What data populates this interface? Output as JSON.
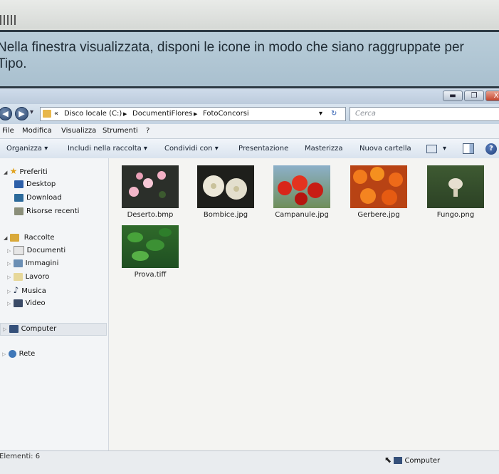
{
  "question": {
    "text": "Nella finestra visualizzata, disponi le icone in modo che siano raggruppate per Tipo."
  },
  "window": {
    "controls": {
      "minimize": "▬",
      "maximize": "❐",
      "close": "X"
    },
    "nav": {
      "back": "◀",
      "forward": "▶",
      "history": "▾"
    },
    "address": {
      "prefix": "«",
      "segments": [
        "Disco locale (C:)",
        "DocumentiFlores",
        "FotoConcorsi"
      ],
      "separator": "▶",
      "dropdown": "▾",
      "refresh": "↻"
    },
    "search": {
      "placeholder": "Cerca"
    }
  },
  "menu": [
    "File",
    "Modifica",
    "Visualizza",
    "Strumenti",
    "?"
  ],
  "toolbar": {
    "organize": "Organizza ▾",
    "include": "Includi nella raccolta ▾",
    "share": "Condividi con ▾",
    "present": "Presentazione",
    "burn": "Masterizza",
    "new_folder": "Nuova cartella",
    "view": "▾",
    "help": "?"
  },
  "sidebar": {
    "favorites": {
      "label": "Preferiti",
      "items": [
        "Desktop",
        "Download",
        "Risorse recenti"
      ]
    },
    "libraries": {
      "label": "Raccolte",
      "items": [
        "Documenti",
        "Immagini",
        "Lavoro",
        "Musica",
        "Video"
      ]
    },
    "computer": "Computer",
    "network": "Rete"
  },
  "files": [
    {
      "name": "Deserto.bmp",
      "icon": "pink-flowers-thumbnail"
    },
    {
      "name": "Bombice.jpg",
      "icon": "white-flowers-thumbnail"
    },
    {
      "name": "Campanule.jpg",
      "icon": "red-flowers-thumbnail"
    },
    {
      "name": "Gerbere.jpg",
      "icon": "orange-flowers-thumbnail"
    },
    {
      "name": "Fungo.png",
      "icon": "mushroom-thumbnail"
    },
    {
      "name": "Prova.tiff",
      "icon": "green-leaves-thumbnail"
    }
  ],
  "status": {
    "count": "Elementi: 6"
  },
  "taskbar": {
    "computer": "Computer"
  }
}
